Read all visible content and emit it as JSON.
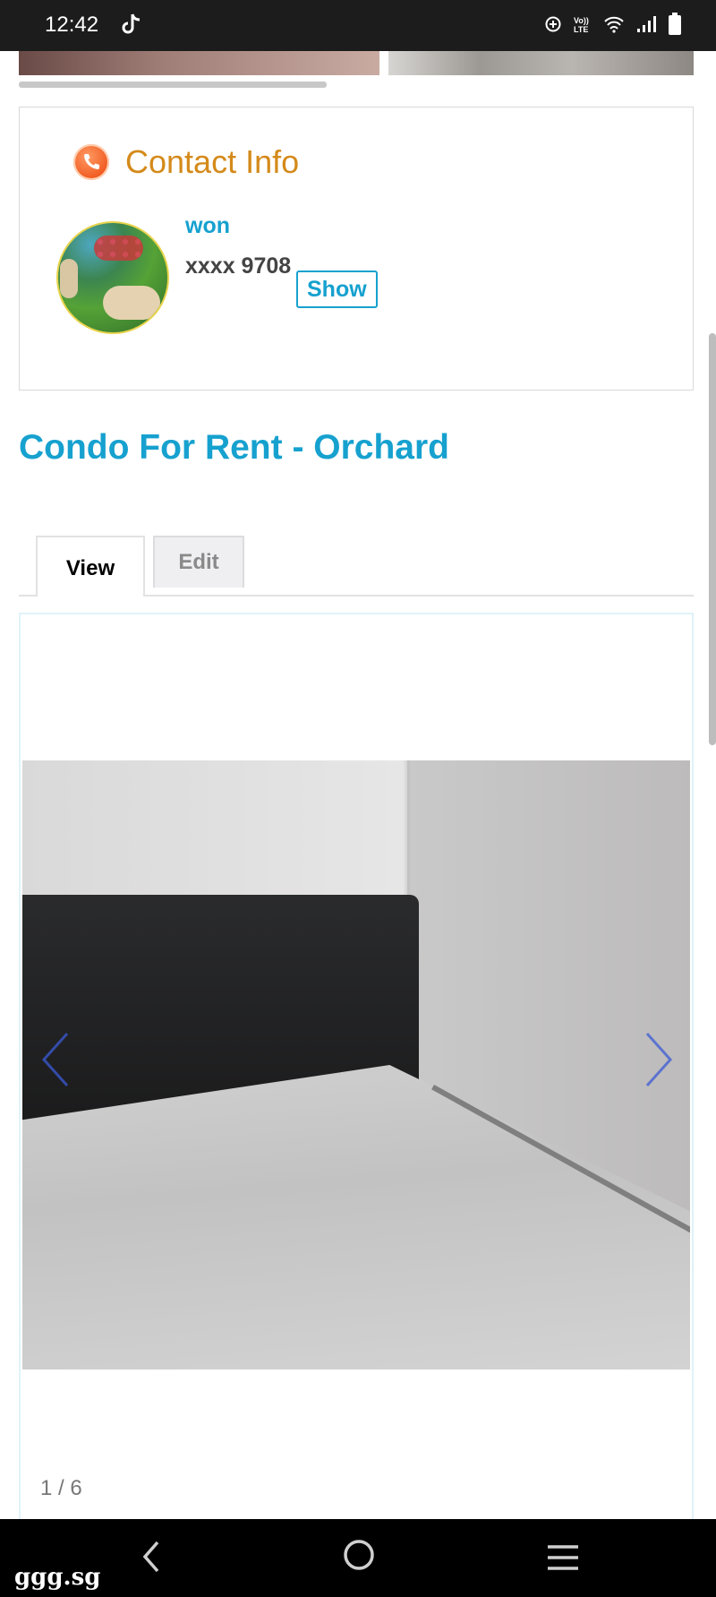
{
  "status_bar": {
    "time": "12:42",
    "app_icon": "tiktok-icon",
    "icons": [
      "data-saver-icon",
      "volte-icon",
      "wifi-icon",
      "signal-icon",
      "battery-icon"
    ]
  },
  "contact": {
    "header_icon": "phone-icon",
    "title": "Contact Info",
    "name": "won",
    "phone_masked": "xxxx 9708",
    "show_label": "Show"
  },
  "listing": {
    "title": "Condo For Rent - Orchard"
  },
  "tabs": [
    {
      "label": "View",
      "active": true
    },
    {
      "label": "Edit",
      "active": false
    }
  ],
  "gallery": {
    "counter": "1 / 6",
    "prev_icon": "chevron-left-icon",
    "next_icon": "chevron-right-icon"
  },
  "nav_bar": {
    "watermark": "ggg.sg",
    "back_icon": "back-icon",
    "home_icon": "home-icon",
    "recents_icon": "recents-icon"
  },
  "colors": {
    "accent": "#16a1cf",
    "contact_title": "#d48a1a"
  }
}
